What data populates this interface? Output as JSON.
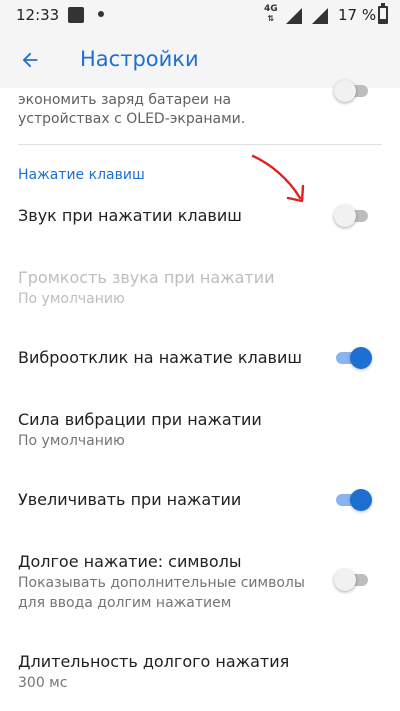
{
  "status_bar": {
    "time": "12:33",
    "network": "4G",
    "battery": "17 %"
  },
  "app_bar": {
    "title": "Настройки"
  },
  "items": {
    "oled_line1": "экономить заряд батареи на",
    "oled_line2": "устройствах с OLED-экранами.",
    "section_header": "Нажатие клавиш",
    "key_sound": "Звук при нажатии клавиш",
    "volume_title": "Громкость звука при нажатии",
    "volume_sub": "По умолчанию",
    "vibration_title": "Виброотклик на нажатие клавиш",
    "vibration_strength_title": "Сила вибрации при нажатии",
    "vibration_strength_sub": "По умолчанию",
    "magnify_title": "Увеличивать при нажатии",
    "longpress_title": "Долгое нажатие: символы",
    "longpress_sub1": "Показывать дополнительные символы",
    "longpress_sub2": "для ввода долгим нажатием",
    "longpress_duration_title": "Длительность долгого нажатия",
    "longpress_duration_sub": "300 мс"
  },
  "colors": {
    "accent": "#1e6fd2",
    "annotation": "#e02020"
  }
}
